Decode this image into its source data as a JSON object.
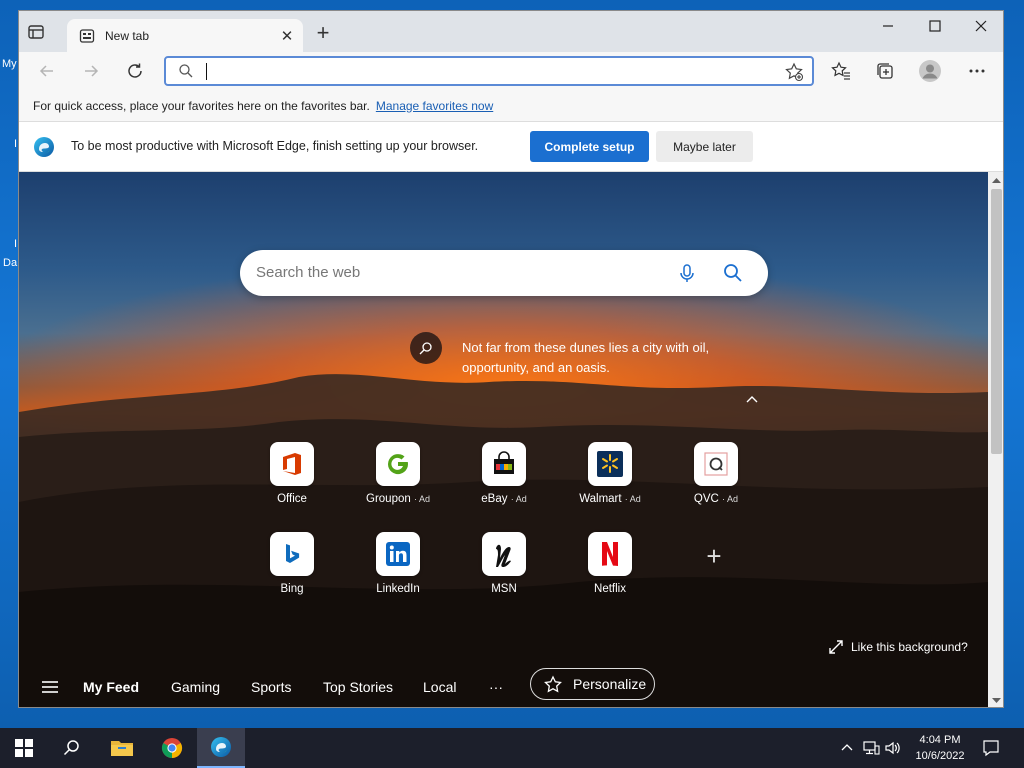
{
  "desktop": {
    "labels": [
      "My",
      "I",
      "I",
      "Da"
    ]
  },
  "browser": {
    "tab": {
      "title": "New tab"
    },
    "address": {
      "value": "",
      "placeholder": ""
    },
    "favorites_bar": {
      "message": "For quick access, place your favorites here on the favorites bar.",
      "link": "Manage favorites now"
    },
    "infobar": {
      "message": "To be most productive with Microsoft Edge, finish setting up your browser.",
      "primary_button": "Complete setup",
      "secondary_button": "Maybe later"
    }
  },
  "newtab": {
    "search_placeholder": "Search the web",
    "background_info": "Not far from these dunes lies a city with oil, opportunity, and an oasis.",
    "tiles": [
      {
        "label": "Office",
        "ad": "",
        "icon": "office-icon",
        "color": "#d83b01"
      },
      {
        "label": "Groupon",
        "ad": "· Ad",
        "icon": "groupon-icon",
        "color": "#53a318"
      },
      {
        "label": "eBay",
        "ad": "· Ad",
        "icon": "ebay-icon",
        "color": "#e53238"
      },
      {
        "label": "Walmart",
        "ad": "· Ad",
        "icon": "walmart-icon",
        "color": "#0071ce"
      },
      {
        "label": "QVC",
        "ad": "· Ad",
        "icon": "qvc-icon",
        "color": "#333333"
      },
      {
        "label": "Bing",
        "ad": "",
        "icon": "bing-icon",
        "color": "#0f6cbd"
      },
      {
        "label": "LinkedIn",
        "ad": "",
        "icon": "linkedin-icon",
        "color": "#0a66c2"
      },
      {
        "label": "MSN",
        "ad": "",
        "icon": "msn-icon",
        "color": "#111111"
      },
      {
        "label": "Netflix",
        "ad": "",
        "icon": "netflix-icon",
        "color": "#e50914"
      }
    ],
    "like_background": "Like this background?",
    "feed": {
      "items": [
        "My Feed",
        "Gaming",
        "Sports",
        "Top Stories",
        "Local"
      ],
      "more": "···",
      "personalize": "Personalize"
    }
  },
  "taskbar": {
    "time": "4:04 PM",
    "date": "10/6/2022"
  },
  "colors": {
    "accent": "#1b6fd0",
    "taskbar": "#1c1f2b",
    "desktop": "#1577d6"
  }
}
